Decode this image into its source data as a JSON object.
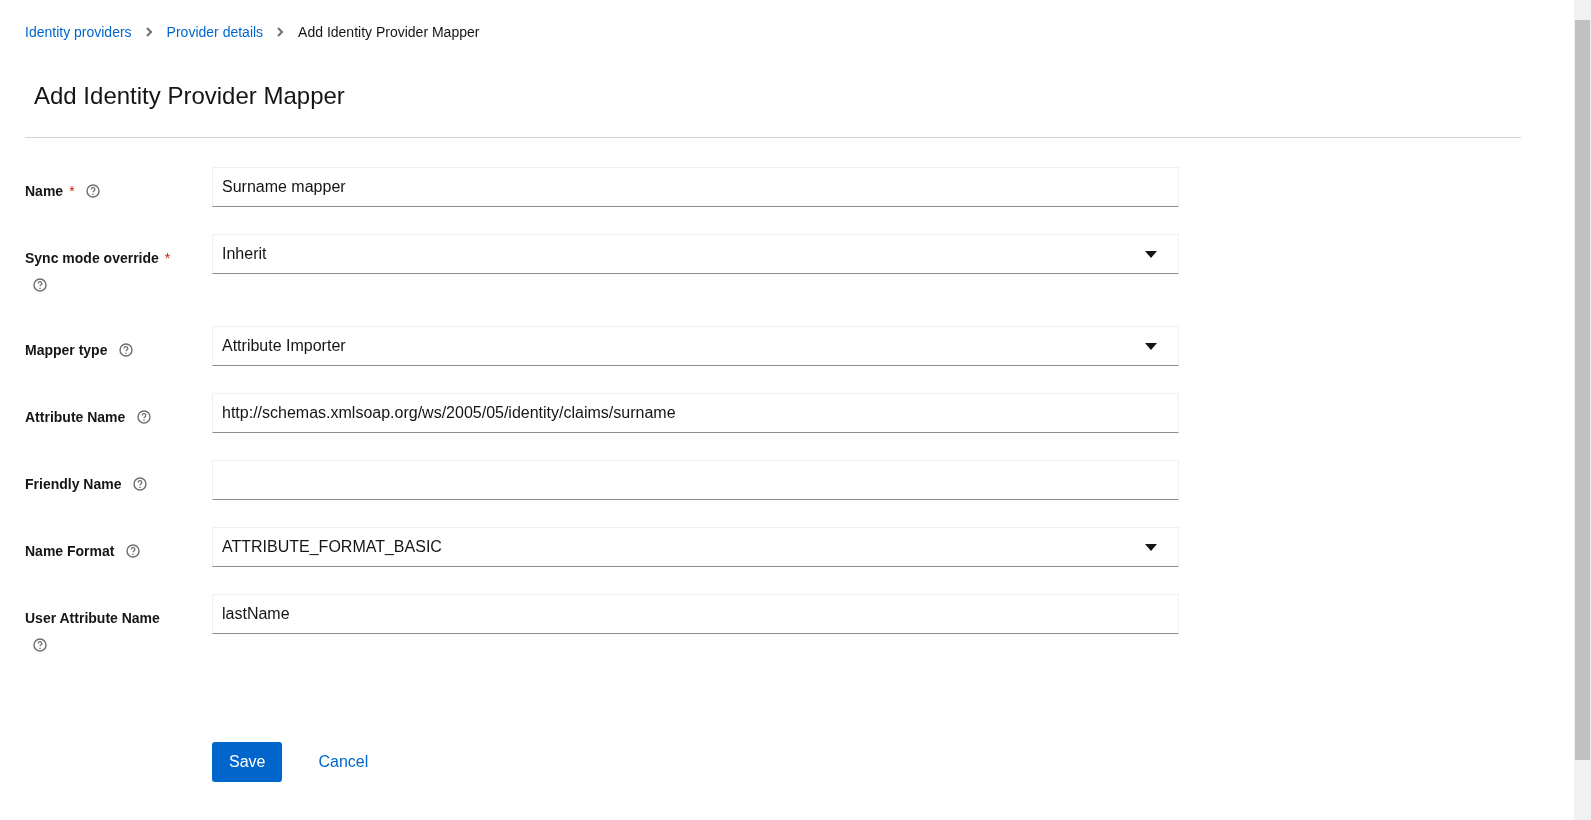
{
  "breadcrumb": [
    {
      "label": "Identity providers",
      "kind": "link"
    },
    {
      "label": "Provider details",
      "kind": "link"
    },
    {
      "label": "Add Identity Provider Mapper",
      "kind": "current"
    }
  ],
  "title": "Add Identity Provider Mapper",
  "fields": [
    {
      "label": "Name",
      "required_mark": "*",
      "kind": "text",
      "value": "Surname mapper"
    },
    {
      "label": "Sync mode override",
      "required_mark": "*",
      "kind": "select",
      "value": "Inherit"
    },
    {
      "label": "Mapper type",
      "kind": "select",
      "value": "Attribute Importer"
    },
    {
      "label": "Attribute Name",
      "kind": "text",
      "value": "http://schemas.xmlsoap.org/ws/2005/05/identity/claims/surname"
    },
    {
      "label": "Friendly Name",
      "kind": "text"
    },
    {
      "label": "Name Format",
      "kind": "select",
      "value": "ATTRIBUTE_FORMAT_BASIC"
    },
    {
      "label": "User Attribute Name",
      "kind": "text",
      "value": "lastName"
    }
  ],
  "actions": [
    {
      "label": "Save",
      "kind": "primary"
    },
    {
      "label": "Cancel",
      "kind": "link"
    }
  ]
}
